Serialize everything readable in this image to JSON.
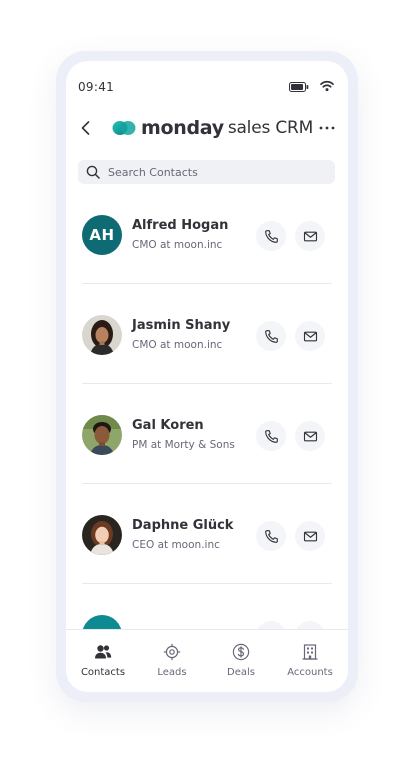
{
  "status_bar": {
    "time": "09:41"
  },
  "header": {
    "logo_bold": "monday",
    "logo_rest": "sales CRM"
  },
  "search": {
    "placeholder": "Search Contacts"
  },
  "contacts": [
    {
      "initials": "AH",
      "name": "Alfred Hogan",
      "title": "CMO at moon.inc",
      "avatar": "initials"
    },
    {
      "initials": "",
      "name": "Jasmin Shany",
      "title": "CMO at moon.inc",
      "avatar": "photo"
    },
    {
      "initials": "",
      "name": "Gal Koren",
      "title": "PM at Morty & Sons",
      "avatar": "photo"
    },
    {
      "initials": "",
      "name": "Daphne Glück",
      "title": "CEO at moon.inc",
      "avatar": "photo"
    },
    {
      "initials": "",
      "name": "",
      "title": "",
      "avatar": "initials"
    }
  ],
  "tabs": [
    {
      "label": "Contacts",
      "icon": "people-icon",
      "active": true
    },
    {
      "label": "Leads",
      "icon": "target-icon",
      "active": false
    },
    {
      "label": "Deals",
      "icon": "dollar-icon",
      "active": false
    },
    {
      "label": "Accounts",
      "icon": "building-icon",
      "active": false
    }
  ],
  "colors": {
    "brand_teal": "#0e6b73",
    "text": "#323338",
    "muted": "#676879",
    "frame": "#eceef8"
  }
}
